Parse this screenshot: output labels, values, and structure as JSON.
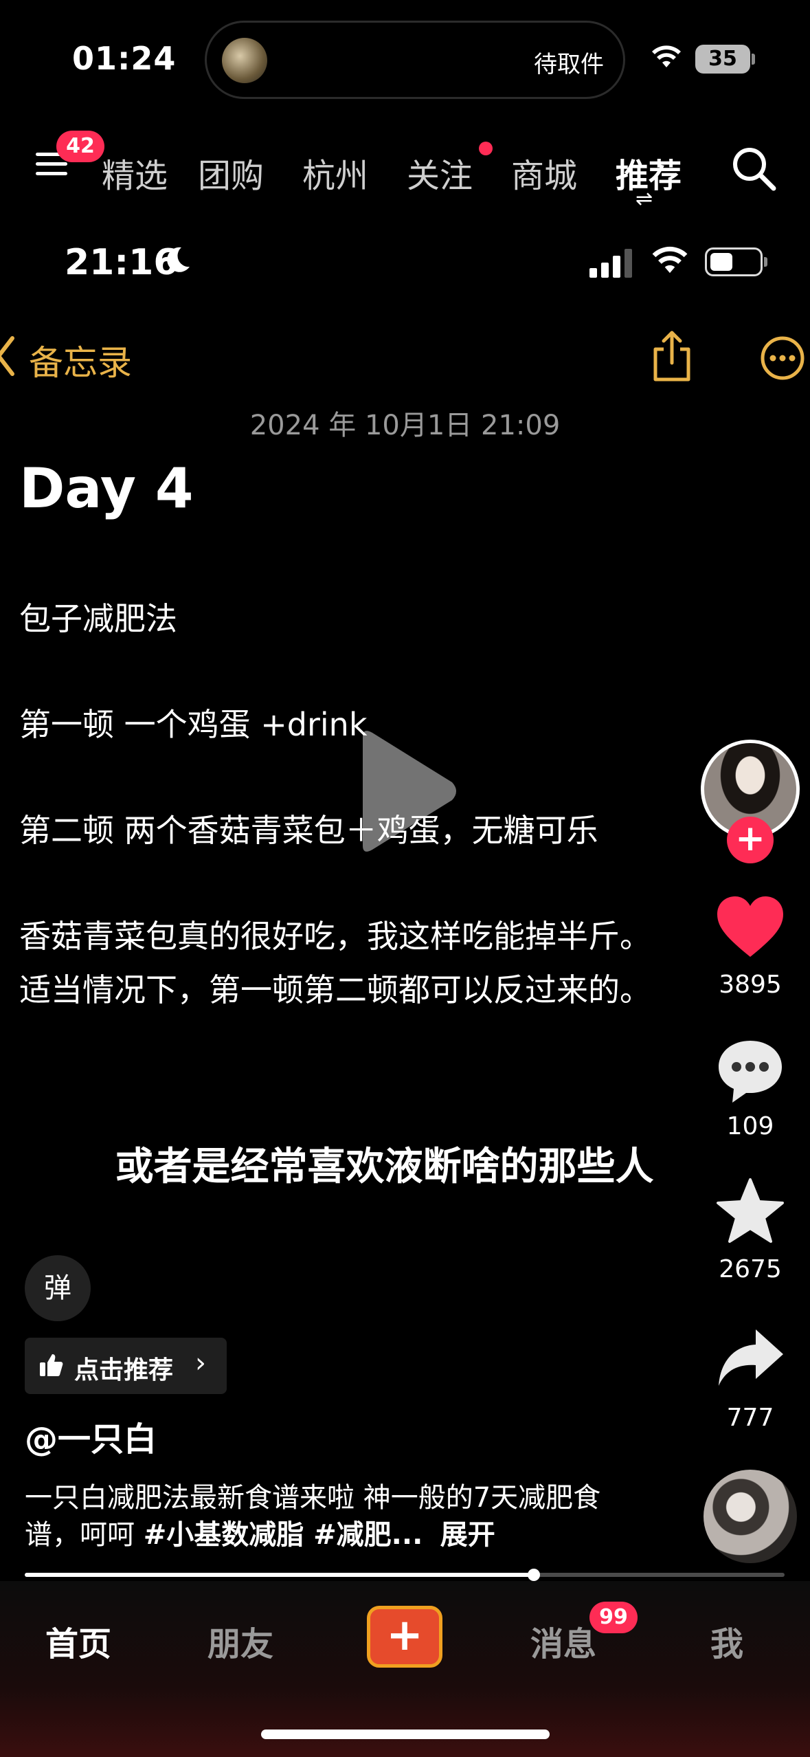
{
  "status_outer": {
    "time": "01:24",
    "island_label": "待取件",
    "battery": "35"
  },
  "top_nav": {
    "menu_badge": "42",
    "tabs": [
      "精选",
      "团购",
      "杭州",
      "关注",
      "商城",
      "推荐"
    ],
    "active_tab": "推荐",
    "follow_has_dot": true,
    "swap_glyph": "⇌"
  },
  "inner_status": {
    "time": "21:16"
  },
  "note": {
    "back_label": "备忘录",
    "date": "2024 年 10月1日 21:09",
    "title": "Day 4",
    "lines": [
      "包子减肥法",
      "第一顿 一个鸡蛋 +drink",
      "第二顿 两个香菇青菜包＋鸡蛋，无糖可乐",
      "香菇青菜包真的很好吃，我这样吃能掉半斤。",
      "适当情况下，第一顿第二顿都可以反过来的。"
    ]
  },
  "subtitle": "或者是经常喜欢液断啥的那些人",
  "rail": {
    "follow_plus": "+",
    "likes": "3895",
    "comments": "109",
    "favorites": "2675",
    "shares": "777"
  },
  "video_info": {
    "danmaku_label": "弹",
    "recommend_label": "点击推荐",
    "recommend_chevron": "›",
    "author": "@一只白",
    "desc_text": "一只白减肥法最新食谱来啦 神一般的7天减肥食谱，呵呵 ",
    "hashtags": "#小基数减脂 #减肥...",
    "expand": "展开",
    "progress": 0.67
  },
  "tabbar": {
    "home": "首页",
    "friends": "朋友",
    "plus": "+",
    "messages": "消息",
    "messages_badge": "99",
    "me": "我"
  },
  "colors": {
    "accent_red": "#fe2c55",
    "notes_yellow": "#e9b349",
    "plus_orange": "#f0a020"
  }
}
